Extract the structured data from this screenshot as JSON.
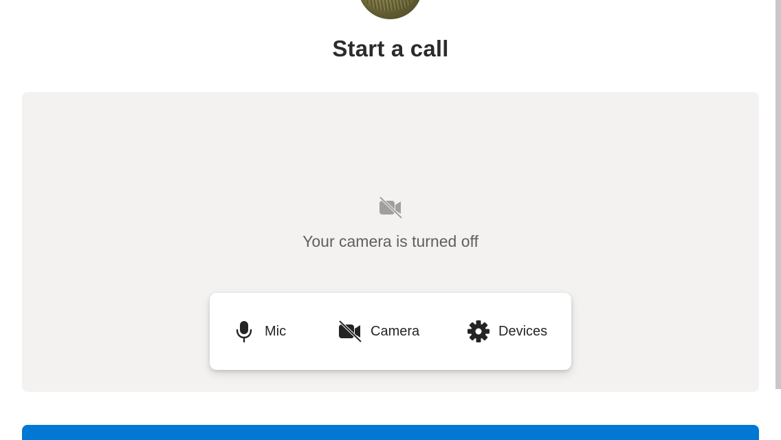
{
  "header": {
    "title": "Start a call"
  },
  "preview": {
    "status_text": "Your camera is turned off",
    "status_icon": "camera-off-icon"
  },
  "controls": {
    "mic": {
      "label": "Mic",
      "icon": "microphone-icon"
    },
    "camera": {
      "label": "Camera",
      "icon": "camera-off-icon"
    },
    "devices": {
      "label": "Devices",
      "icon": "gear-icon"
    }
  },
  "colors": {
    "primary": "#0078d4",
    "preview_bg": "#f3f2f1",
    "text_dark": "#242424",
    "text_muted": "#5f5f5f"
  }
}
